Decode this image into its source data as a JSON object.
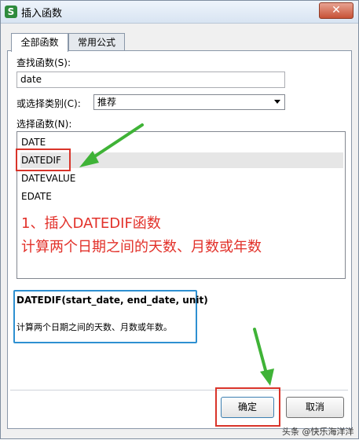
{
  "window": {
    "title": "插入函数",
    "app_icon_letter": "S",
    "close_symbol": "✕"
  },
  "tabs": [
    {
      "label": "全部函数",
      "active": true
    },
    {
      "label": "常用公式",
      "active": false
    }
  ],
  "search": {
    "label": "查找函数(S):",
    "value": "date"
  },
  "category": {
    "label": "或选择类别(C):",
    "value": "推荐"
  },
  "function_list": {
    "label": "选择函数(N):",
    "items": [
      "DATE",
      "DATEDIF",
      "DATEVALUE",
      "EDATE"
    ],
    "selected_index": 1
  },
  "annotation": {
    "line1": "1、插入DATEDIF函数",
    "line2": "计算两个日期之间的天数、月数或年数",
    "color": "#e2312a"
  },
  "description": {
    "signature": "DATEDIF(start_date, end_date, unit)",
    "text": "计算两个日期之间的天数、月数或年数。"
  },
  "buttons": {
    "ok": "确定",
    "cancel": "取消"
  },
  "watermark": "头条 @快乐海洋洋",
  "colors": {
    "highlight_red": "#d9342a",
    "highlight_blue": "#2e90d1",
    "arrow_green": "#3fb337"
  }
}
